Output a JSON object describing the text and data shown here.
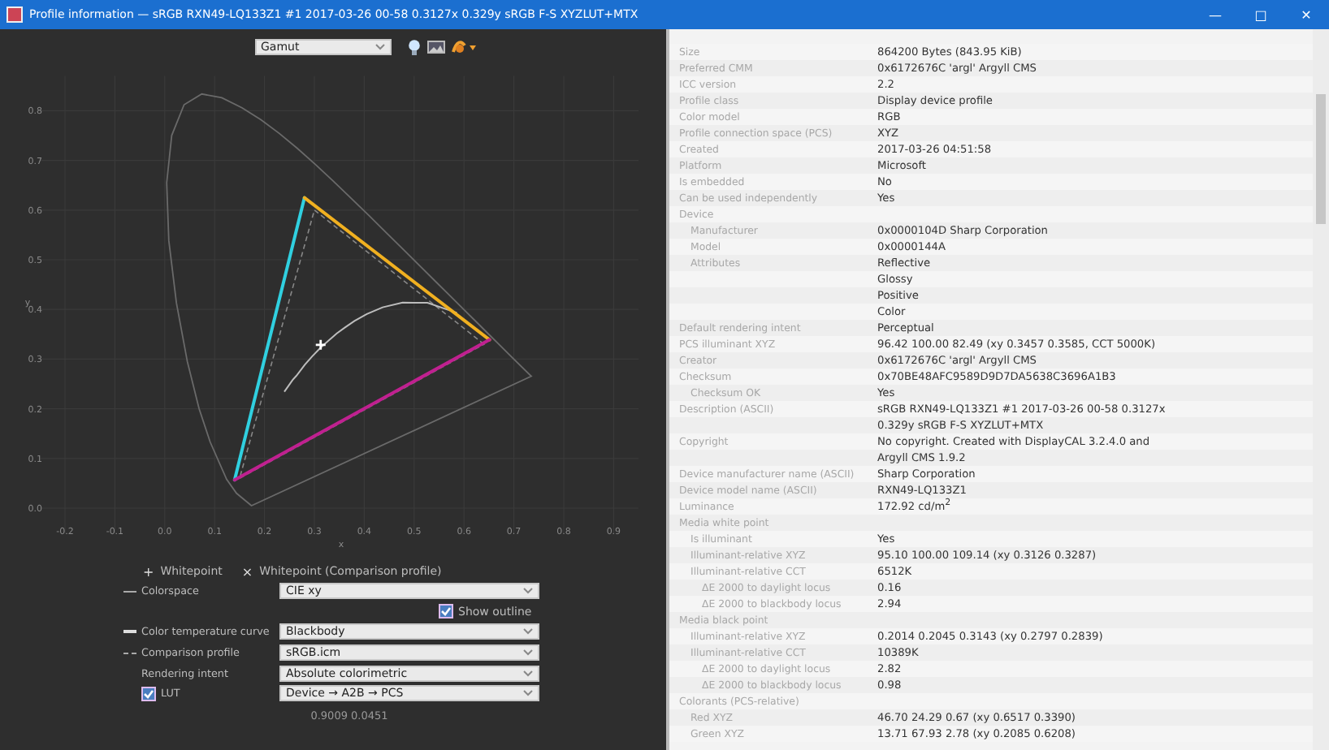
{
  "window": {
    "title": "Profile information — sRGB RXN49-LQ133Z1 #1 2017-03-26 00-58 0.3127x 0.329y sRGB F-S XYZLUT+MTX",
    "controls": [
      "—",
      "□",
      "✕"
    ]
  },
  "toolbar": {
    "view_select": "Gamut"
  },
  "plot": {
    "chart_data": {
      "type": "line",
      "xlabel": "x",
      "ylabel": "y",
      "x": [
        0.14,
        0.28,
        0.651,
        0.14
      ],
      "series": [
        {
          "color": "#30d0e0",
          "values": [
            0.057,
            0.625,
            null,
            null
          ]
        },
        {
          "color": "#f0b020",
          "values": [
            null,
            0.625,
            0.339,
            null
          ]
        },
        {
          "color": "#c02090",
          "values": [
            null,
            null,
            0.339,
            0.057
          ]
        }
      ],
      "xlim": [
        -0.25,
        0.95
      ],
      "ylim": [
        -0.05,
        0.87
      ],
      "xticks": [
        -0.2,
        -0.1,
        {
          "value": 0,
          "label": "0.0"
        },
        0.1,
        0.2,
        0.3,
        0.4,
        0.5,
        0.6,
        0.7,
        0.8,
        0.9
      ],
      "yticks": [
        {
          "value": 0,
          "label": "0.0"
        },
        0.1,
        0.2,
        0.3,
        0.4,
        0.5,
        0.6,
        0.7,
        0.8
      ],
      "grid": true
    }
  },
  "legend": [
    {
      "symbol": "+",
      "label": "Whitepoint"
    },
    {
      "symbol": "×",
      "label": "Whitepoint (Comparison profile)"
    }
  ],
  "options": [
    {
      "kind": "lineselect",
      "label": "Colorspace",
      "value": "CIE xy"
    },
    {
      "kind": "checkbox",
      "label": "Show outline",
      "checked": true
    },
    {
      "kind": "thickselect",
      "label": "Color temperature curve",
      "value": "Blackbody"
    },
    {
      "kind": "dashedselect",
      "label": "Comparison profile",
      "value": "sRGB.icm"
    },
    {
      "kind": "select",
      "label": "Rendering intent",
      "value": "Absolute colorimetric"
    },
    {
      "kind": "checkselect",
      "label": "LUT",
      "checked": true,
      "value": "Device → A2B → PCS"
    }
  ],
  "cursor_readout": "0.9009 0.0451",
  "info": [
    {
      "label": "Size",
      "values": [
        "864200 Bytes (843.95 KiB)"
      ]
    },
    {
      "label": "Preferred CMM",
      "values": [
        "0x6172676C 'argl' Argyll CMS"
      ]
    },
    {
      "label": "ICC version",
      "values": [
        "2.2"
      ]
    },
    {
      "label": "Profile class",
      "values": [
        "Display device profile"
      ]
    },
    {
      "label": "Color model",
      "values": [
        "RGB"
      ]
    },
    {
      "label": "Profile connection space (PCS)",
      "values": [
        "XYZ"
      ]
    },
    {
      "label": "Created",
      "values": [
        "2017-03-26 04:51:58"
      ]
    },
    {
      "label": "Platform",
      "values": [
        "Microsoft"
      ]
    },
    {
      "label": "Is embedded",
      "values": [
        "No"
      ]
    },
    {
      "label": "Can be used independently",
      "values": [
        "Yes"
      ]
    },
    {
      "label": "Device",
      "children": [
        {
          "label": "Manufacturer",
          "values": [
            "0x0000104D Sharp Corporation"
          ]
        },
        {
          "label": "Model",
          "values": [
            "0x0000144A"
          ]
        },
        {
          "label": "Attributes",
          "values": [
            "Reflective",
            "Glossy",
            "Positive",
            "Color"
          ]
        }
      ]
    },
    {
      "label": "Default rendering intent",
      "values": [
        "Perceptual"
      ]
    },
    {
      "label": "PCS illuminant XYZ",
      "values": [
        "96.42 100.00  82.49 (xy 0.3457 0.3585, CCT 5000K)"
      ]
    },
    {
      "label": "Creator",
      "values": [
        "0x6172676C 'argl' Argyll CMS"
      ]
    },
    {
      "label": "Checksum",
      "values": [
        "0x70BE48AFC9589D9D7DA5638C3696A1B3"
      ],
      "children": [
        {
          "label": "Checksum OK",
          "values": [
            "Yes"
          ]
        }
      ]
    },
    {
      "label": "Description (ASCII)",
      "values": [
        "sRGB RXN49-LQ133Z1 #1 2017-03-26 00-58 0.3127x",
        "0.329y sRGB F-S XYZLUT+MTX"
      ]
    },
    {
      "label": "Copyright",
      "values": [
        "No copyright. Created with DisplayCAL 3.2.4.0 and",
        "Argyll CMS 1.9.2"
      ]
    },
    {
      "label": "Device manufacturer name (ASCII)",
      "values": [
        "Sharp Corporation"
      ]
    },
    {
      "label": "Device model name (ASCII)",
      "values": [
        "RXN49-LQ133Z1"
      ]
    },
    {
      "label": "Luminance",
      "values": [
        "172.92 cd/m$^{2}$"
      ]
    },
    {
      "label": "Media white point",
      "children": [
        {
          "label": "Is illuminant",
          "values": [
            "Yes"
          ]
        },
        {
          "label": "Illuminant-relative XYZ",
          "values": [
            "95.10 100.00 109.14 (xy 0.3126 0.3287)"
          ]
        },
        {
          "label": "Illuminant-relative CCT",
          "values": [
            "6512K"
          ],
          "children": [
            {
              "label": "ΔE 2000 to daylight locus",
              "values": [
                "0.16"
              ]
            },
            {
              "label": "ΔE 2000 to blackbody locus",
              "values": [
                "2.94"
              ]
            }
          ]
        }
      ]
    },
    {
      "label": "Media black point",
      "children": [
        {
          "label": "Illuminant-relative XYZ",
          "values": [
            "0.2014 0.2045 0.3143 (xy 0.2797 0.2839)"
          ]
        },
        {
          "label": "Illuminant-relative CCT",
          "values": [
            "10389K"
          ],
          "children": [
            {
              "label": "ΔE 2000 to daylight locus",
              "values": [
                "2.82"
              ]
            },
            {
              "label": "ΔE 2000 to blackbody locus",
              "values": [
                "0.98"
              ]
            }
          ]
        }
      ]
    },
    {
      "label": "Colorants (PCS-relative)",
      "children": [
        {
          "label": "Red XYZ",
          "values": [
            "46.70  24.29   0.67 (xy 0.6517 0.3390)"
          ]
        },
        {
          "label": "Green XYZ",
          "values": [
            "13.71  67.93   2.78 (xy 0.2085 0.6208)"
          ]
        }
      ]
    }
  ]
}
